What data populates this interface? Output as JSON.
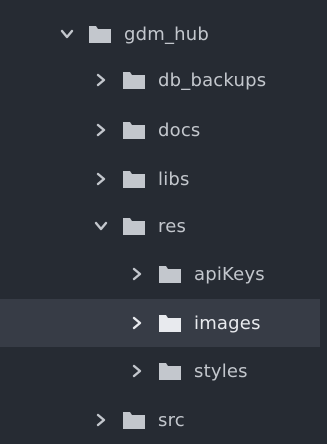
{
  "colors": {
    "background": "#262b33",
    "selected_row": "#373c46",
    "text": "#c3c7cd",
    "folder": "#c3c7cd"
  },
  "tree": [
    {
      "label": "gdm_hub",
      "expanded": true,
      "icon": "chevron-down-icon",
      "folder_icon": "folder-icon"
    },
    {
      "label": "db_backups",
      "expanded": false,
      "icon": "chevron-right-icon",
      "folder_icon": "folder-icon"
    },
    {
      "label": "docs",
      "expanded": false,
      "icon": "chevron-right-icon",
      "folder_icon": "folder-icon"
    },
    {
      "label": "libs",
      "expanded": false,
      "icon": "chevron-right-icon",
      "folder_icon": "folder-icon"
    },
    {
      "label": "res",
      "expanded": true,
      "icon": "chevron-down-icon",
      "folder_icon": "folder-icon"
    },
    {
      "label": "apiKeys",
      "expanded": false,
      "icon": "chevron-right-icon",
      "folder_icon": "folder-icon"
    },
    {
      "label": "images",
      "expanded": false,
      "selected": true,
      "icon": "chevron-right-icon",
      "folder_icon": "folder-icon"
    },
    {
      "label": "styles",
      "expanded": false,
      "icon": "chevron-right-icon",
      "folder_icon": "folder-icon"
    },
    {
      "label": "src",
      "expanded": false,
      "icon": "chevron-right-icon",
      "folder_icon": "folder-icon"
    }
  ]
}
